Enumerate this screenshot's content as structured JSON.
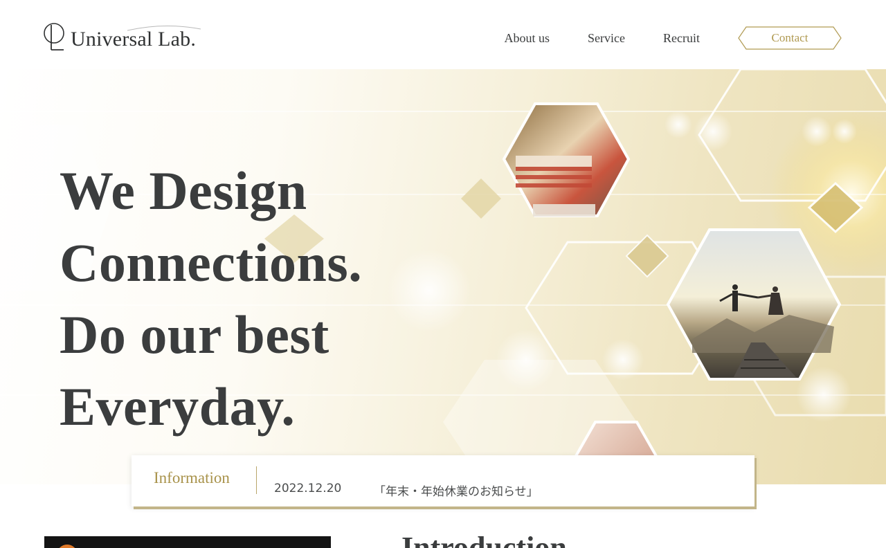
{
  "brand": {
    "name": "Universal Lab."
  },
  "nav": {
    "items": [
      {
        "label": "About us"
      },
      {
        "label": "Service"
      },
      {
        "label": "Recruit"
      }
    ],
    "contact_label": "Contact"
  },
  "hero": {
    "headline": [
      "We Design",
      "Connections.",
      "Do our best",
      "Everyday."
    ]
  },
  "information": {
    "title": "Information",
    "date": "2022.12.20",
    "text": "「年末・年始休業のお知らせ」"
  },
  "intro": {
    "title": "Introduction"
  },
  "colors": {
    "accent_gold": "#b09a52",
    "text_dark": "#3b3d3e",
    "video_badge": "#e07a2a"
  }
}
